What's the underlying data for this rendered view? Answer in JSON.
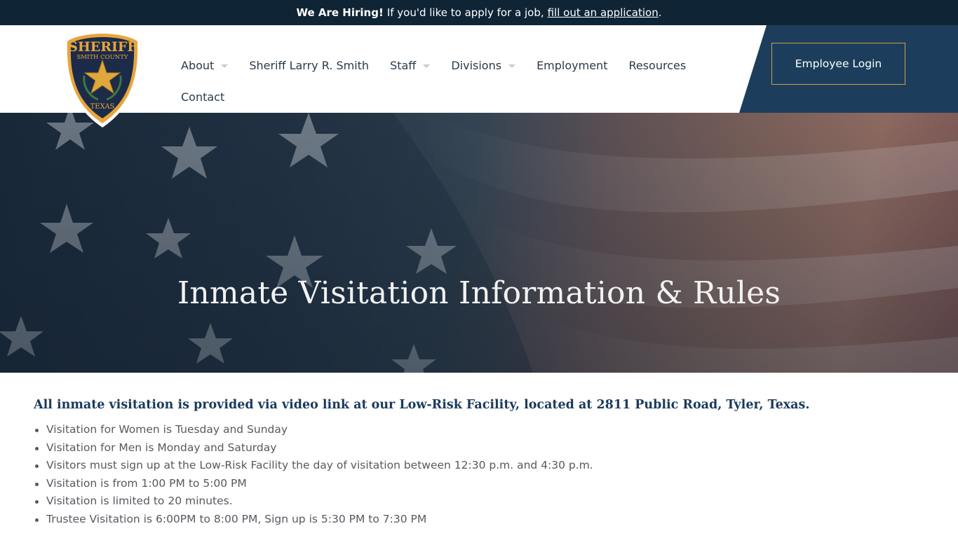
{
  "banner": {
    "bold": "We Are Hiring!",
    "text": "If you'd like to apply for a job,",
    "link": "fill out an application",
    "end": "."
  },
  "logo": {
    "top_text": "SHERIFF",
    "middle_text": "SMITH COUNTY",
    "bottom_text": "TEXAS",
    "colors": {
      "gold": "#e8a53a",
      "navy": "#1c2b4a",
      "star": "#e0a83c"
    }
  },
  "nav": {
    "items": [
      {
        "label": "About",
        "dropdown": true
      },
      {
        "label": "Sheriff Larry R. Smith",
        "dropdown": false
      },
      {
        "label": "Staff",
        "dropdown": true
      },
      {
        "label": "Divisions",
        "dropdown": true
      },
      {
        "label": "Employment",
        "dropdown": false
      },
      {
        "label": "Resources",
        "dropdown": false
      },
      {
        "label": "Contact",
        "dropdown": false
      }
    ]
  },
  "login": {
    "label": "Employee Login"
  },
  "hero": {
    "title": "Inmate Visitation Information & Rules"
  },
  "content": {
    "lead": "All inmate visitation is provided via video link at our Low-Risk Facility, located at 2811 Public Road, Tyler, Texas.",
    "rules": [
      "Visitation for Women is Tuesday and Sunday",
      "Visitation for Men is Monday and Saturday",
      "Visitors must sign up at the Low-Risk Facility the day of visitation between 12:30 p.m. and 4:30 p.m.",
      "Visitation is from 1:00 PM to 5:00 PM",
      "Visitation is limited to 20 minutes.",
      "Trustee Visitation is 6:00PM to 8:00 PM, Sign up is 5:30 PM to 7:30 PM"
    ]
  },
  "colors": {
    "topbar": "#0f2536",
    "header_accent": "#1c3e5c",
    "login_border": "#c9a24a",
    "heading": "#1a3a5c"
  }
}
